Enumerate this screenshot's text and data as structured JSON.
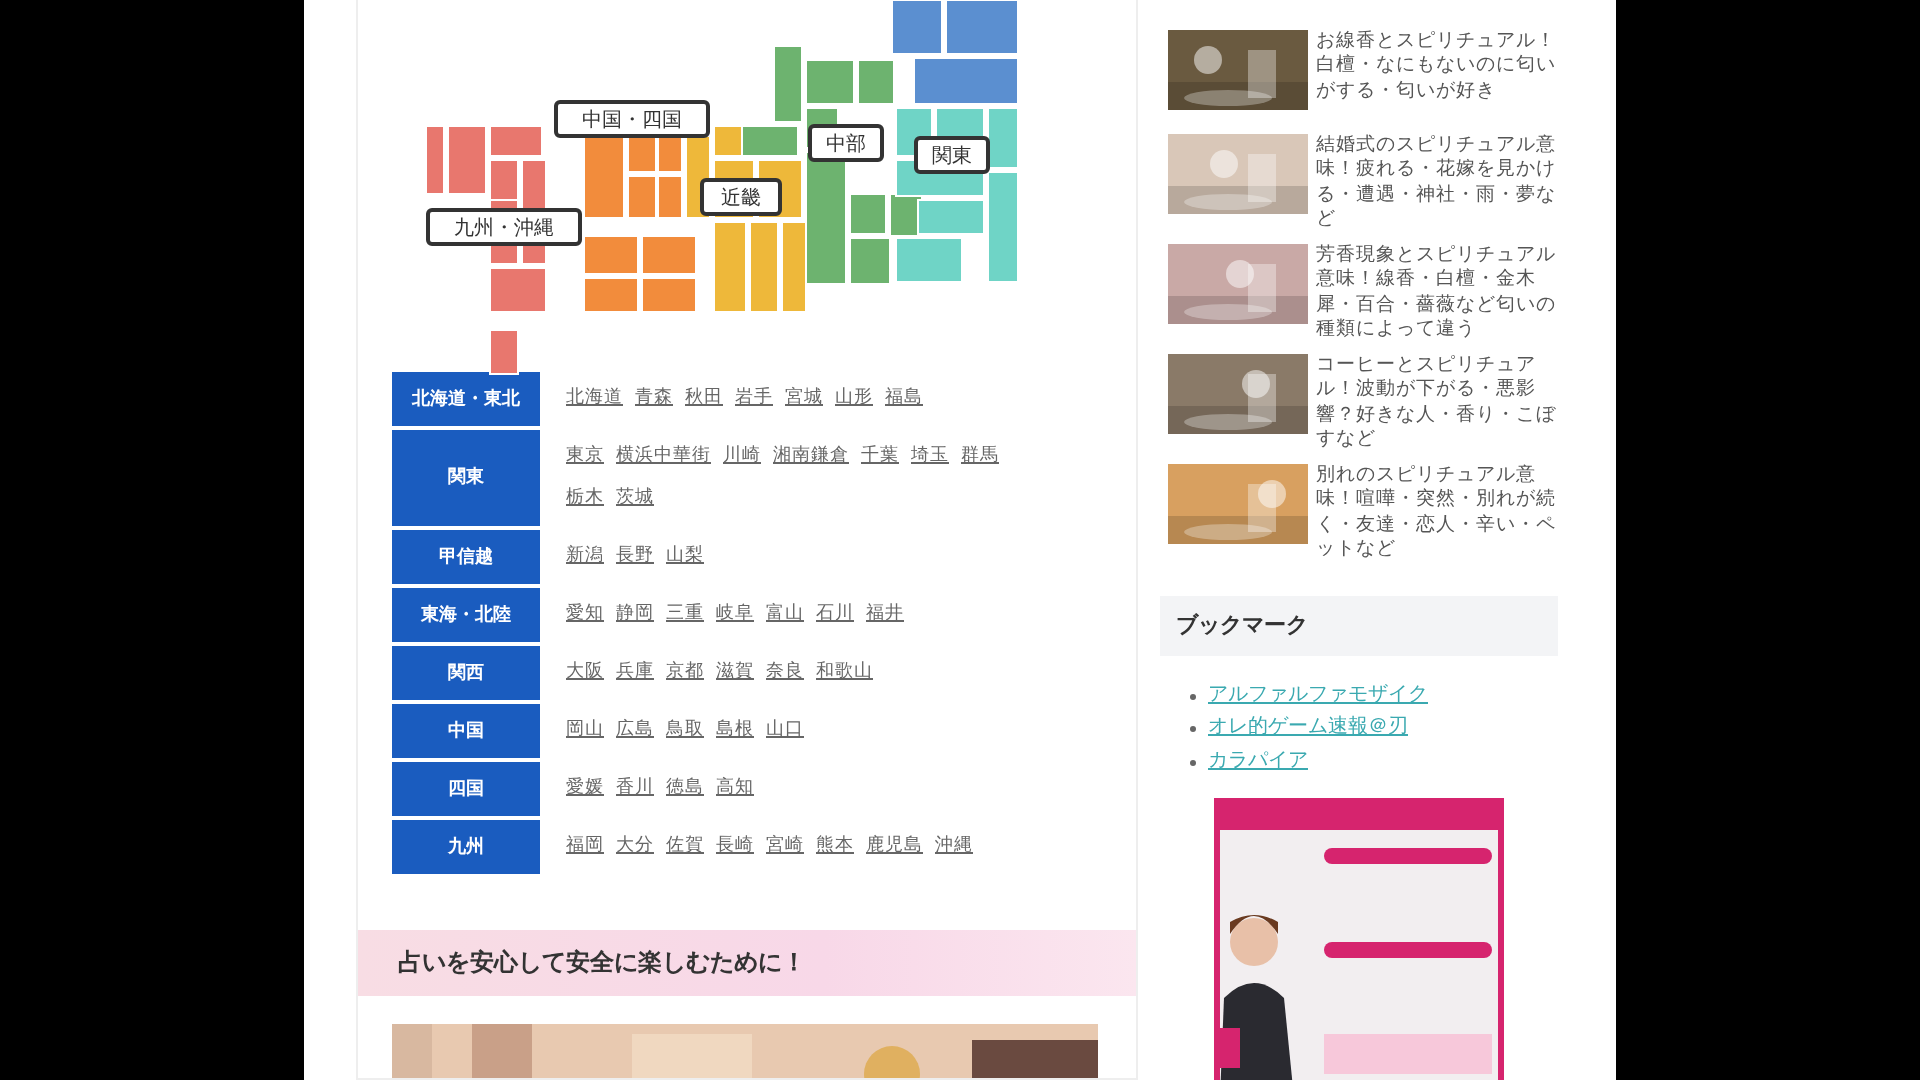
{
  "map": {
    "labels": [
      "中国・四国",
      "九州・沖縄",
      "近畿",
      "中部",
      "関東"
    ]
  },
  "areas": [
    {
      "name": "北海道・東北",
      "links": [
        "北海道",
        "青森",
        "秋田",
        "岩手",
        "宮城",
        "山形",
        "福島"
      ]
    },
    {
      "name": "関東",
      "links": [
        "東京",
        "横浜中華街",
        "川崎",
        "湘南鎌倉",
        "千葉",
        "埼玉",
        "群馬",
        "栃木",
        "茨城"
      ]
    },
    {
      "name": "甲信越",
      "links": [
        "新潟",
        "長野",
        "山梨"
      ]
    },
    {
      "name": "東海・北陸",
      "links": [
        "愛知",
        "静岡",
        "三重",
        "岐阜",
        "富山",
        "石川",
        "福井"
      ]
    },
    {
      "name": "関西",
      "links": [
        "大阪",
        "兵庫",
        "京都",
        "滋賀",
        "奈良",
        "和歌山"
      ]
    },
    {
      "name": "中国",
      "links": [
        "岡山",
        "広島",
        "鳥取",
        "島根",
        "山口"
      ]
    },
    {
      "name": "四国",
      "links": [
        "愛媛",
        "香川",
        "徳島",
        "高知"
      ]
    },
    {
      "name": "九州",
      "links": [
        "福岡",
        "大分",
        "佐賀",
        "長崎",
        "宮崎",
        "熊本",
        "鹿児島",
        "沖縄"
      ]
    }
  ],
  "section_heading": "占いを安心して安全に楽しむために！",
  "sidebar": {
    "posts": [
      "お線香とスピリチュアル！白檀・なにもないのに匂いがする・匂いが好き",
      "結婚式のスピリチュアル意味！疲れる・花嫁を見かける・遭遇・神社・雨・夢など",
      "芳香現象とスピリチュアル意味！線香・白檀・金木犀・百合・薔薇など匂いの種類によって違う",
      "コーヒーとスピリチュアル！波動が下がる・悪影響？好きな人・香り・こぼすなど",
      "別れのスピリチュアル意味！喧嘩・突然・別れが続く・友達・恋人・辛い・ペットなど"
    ],
    "bookmark_heading": "ブックマーク",
    "bookmarks": [
      "アルファルファモザイク",
      "オレ的ゲーム速報＠刃",
      "カラパイア"
    ]
  }
}
